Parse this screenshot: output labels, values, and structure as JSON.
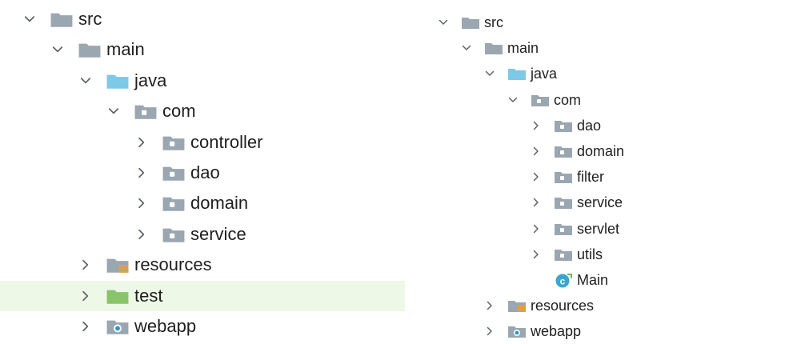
{
  "left_tree": {
    "items": [
      {
        "label": "src",
        "depth": 0,
        "expanded": true,
        "icon": "folder-gray"
      },
      {
        "label": "main",
        "depth": 1,
        "expanded": true,
        "icon": "folder-gray"
      },
      {
        "label": "java",
        "depth": 2,
        "expanded": true,
        "icon": "folder-blue-source"
      },
      {
        "label": "com",
        "depth": 3,
        "expanded": true,
        "icon": "package"
      },
      {
        "label": "controller",
        "depth": 4,
        "expanded": false,
        "icon": "package"
      },
      {
        "label": "dao",
        "depth": 4,
        "expanded": false,
        "icon": "package"
      },
      {
        "label": "domain",
        "depth": 4,
        "expanded": false,
        "icon": "package"
      },
      {
        "label": "service",
        "depth": 4,
        "expanded": false,
        "icon": "package"
      },
      {
        "label": "resources",
        "depth": 2,
        "expanded": false,
        "icon": "folder-resources"
      },
      {
        "label": "test",
        "depth": 2,
        "expanded": false,
        "icon": "folder-green-test",
        "selected": true
      },
      {
        "label": "webapp",
        "depth": 2,
        "expanded": false,
        "icon": "folder-web"
      }
    ]
  },
  "right_tree": {
    "items": [
      {
        "label": "src",
        "depth": 0,
        "expanded": true,
        "icon": "folder-gray"
      },
      {
        "label": "main",
        "depth": 1,
        "expanded": true,
        "icon": "folder-gray"
      },
      {
        "label": "java",
        "depth": 2,
        "expanded": true,
        "icon": "folder-blue-source"
      },
      {
        "label": "com",
        "depth": 3,
        "expanded": true,
        "icon": "package"
      },
      {
        "label": "dao",
        "depth": 4,
        "expanded": false,
        "icon": "package"
      },
      {
        "label": "domain",
        "depth": 4,
        "expanded": false,
        "icon": "package"
      },
      {
        "label": "filter",
        "depth": 4,
        "expanded": false,
        "icon": "package"
      },
      {
        "label": "service",
        "depth": 4,
        "expanded": false,
        "icon": "package"
      },
      {
        "label": "servlet",
        "depth": 4,
        "expanded": false,
        "icon": "package"
      },
      {
        "label": "utils",
        "depth": 4,
        "expanded": false,
        "icon": "package"
      },
      {
        "label": "Main",
        "depth": 4,
        "expanded": null,
        "icon": "java-class"
      },
      {
        "label": "resources",
        "depth": 2,
        "expanded": false,
        "icon": "folder-resources"
      },
      {
        "label": "webapp",
        "depth": 2,
        "expanded": false,
        "icon": "folder-web"
      }
    ]
  },
  "colors": {
    "folder_gray": "#9aa7b0",
    "folder_blue": "#7ec8e8",
    "folder_green": "#89c46a",
    "selection": "#eef8e6",
    "chevron": "#5f6368",
    "resources_lines": "#e6a13b",
    "web_dot": "#3592c4",
    "class_circle": "#3aa6d0"
  }
}
